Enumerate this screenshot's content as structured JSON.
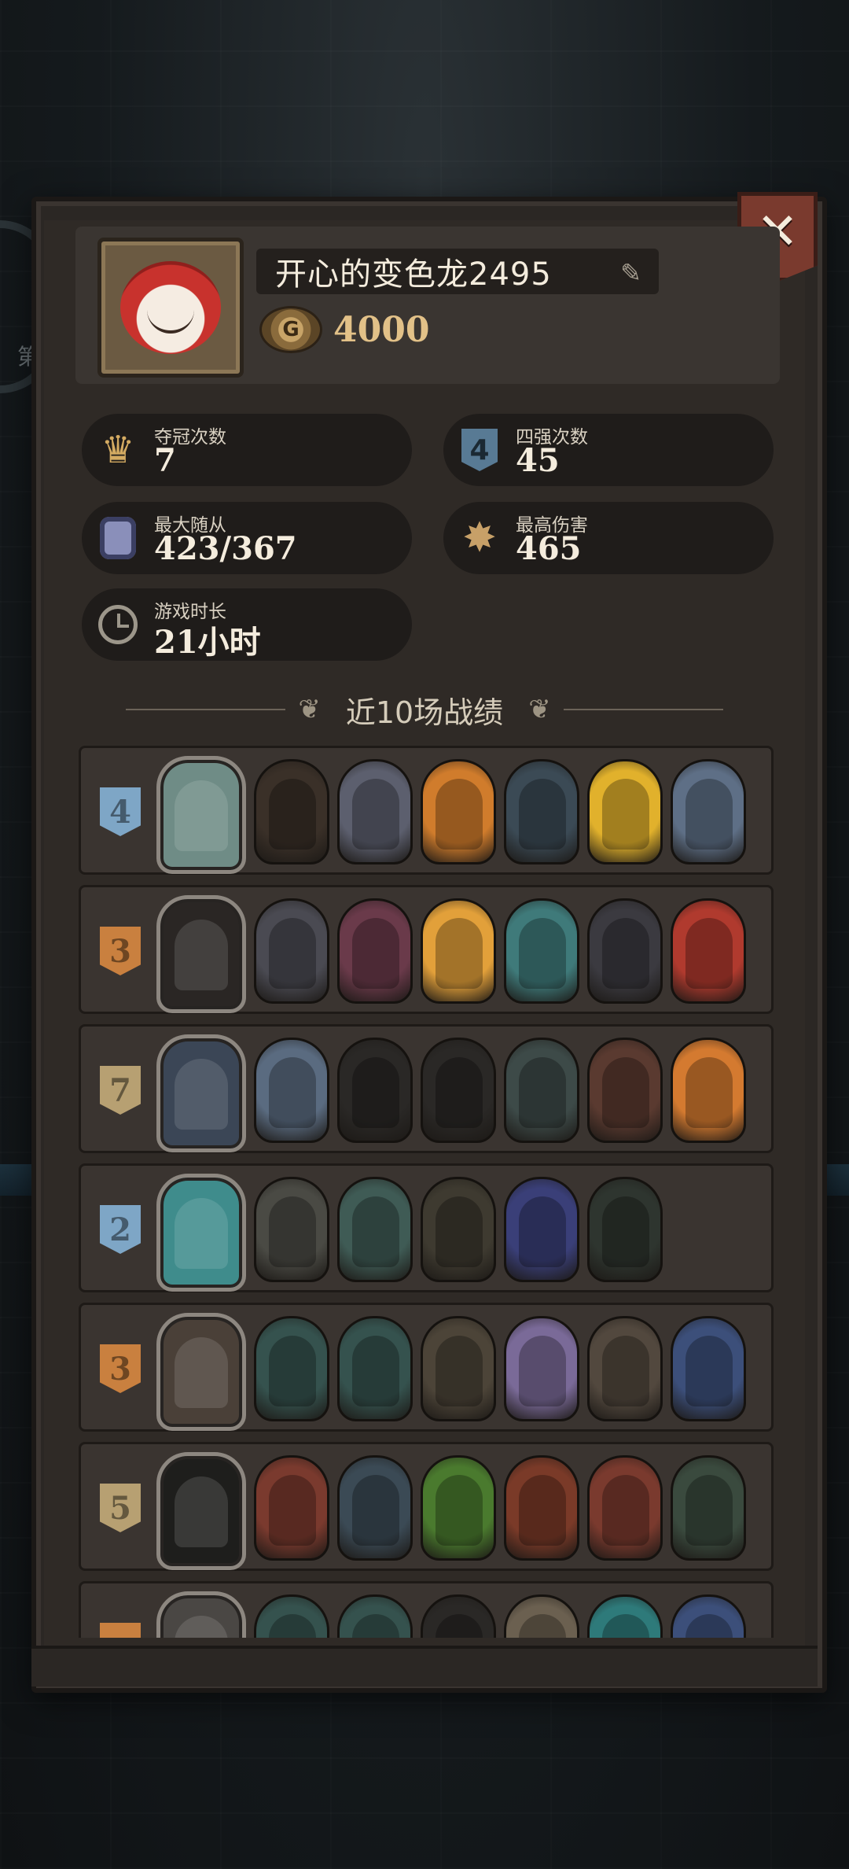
{
  "profile": {
    "name": "开心的变色龙2495",
    "coins": "4000"
  },
  "stats": [
    {
      "label": "夺冠次数",
      "value": "7",
      "icon": "crown-icon"
    },
    {
      "label": "四强次数",
      "value": "45",
      "icon": "rank-4-shield-icon"
    },
    {
      "label": "最大随从",
      "value": "423/367",
      "icon": "minion-icon"
    },
    {
      "label": "最高伤害",
      "value": "465",
      "icon": "damage-burst-icon"
    },
    {
      "label": "游戏时长",
      "value": "21小时",
      "icon": "clock-icon"
    }
  ],
  "section": {
    "title": "近10场战绩"
  },
  "matches": [
    {
      "rank": "4",
      "rank_color": "#7ea6c6",
      "hero_color": "#6f8c86",
      "units": [
        "#3a3028",
        "#5c5f6e",
        "#d07c2c",
        "#3b4a55",
        "#e1b12c",
        "#5e6f86"
      ]
    },
    {
      "rank": "3",
      "rank_color": "#c9803f",
      "hero_color": "#2a2624",
      "units": [
        "#4a4a52",
        "#6a3a4a",
        "#e2a03a",
        "#3f7a7a",
        "#3b3a40",
        "#b03a2e"
      ]
    },
    {
      "rank": "7",
      "rank_color": "#b7a072",
      "hero_color": "#3b4656",
      "units": [
        "#5a6b80",
        "#2a2826",
        "#2a2826",
        "#3d4a48",
        "#5a3a30",
        "#d47a30"
      ]
    },
    {
      "rank": "2",
      "rank_color": "#7ea6c6",
      "hero_color": "#3f8c8c",
      "units": [
        "#4a4a44",
        "#3f5b55",
        "#3e3a30",
        "#3a3f78",
        "#2e352f"
      ]
    },
    {
      "rank": "3",
      "rank_color": "#c9803f",
      "hero_color": "#4a4038",
      "units": [
        "#35524e",
        "#35524e",
        "#4c4438",
        "#7a6a98",
        "#52483e",
        "#3c4f7a"
      ]
    },
    {
      "rank": "5",
      "rank_color": "#b7a072",
      "hero_color": "#1e1e1c",
      "units": [
        "#7a3a2e",
        "#3b4a55",
        "#4a7a2e",
        "#7a3a28",
        "#7a3a2e",
        "#3a4a3e"
      ]
    },
    {
      "rank": "",
      "rank_color": "#c9803f",
      "hero_color": "#4a4744",
      "units": [
        "#35524e",
        "#35524e",
        "#2a2826",
        "#6b6050",
        "#2e7a7a",
        "#3c4f7a"
      ]
    }
  ]
}
